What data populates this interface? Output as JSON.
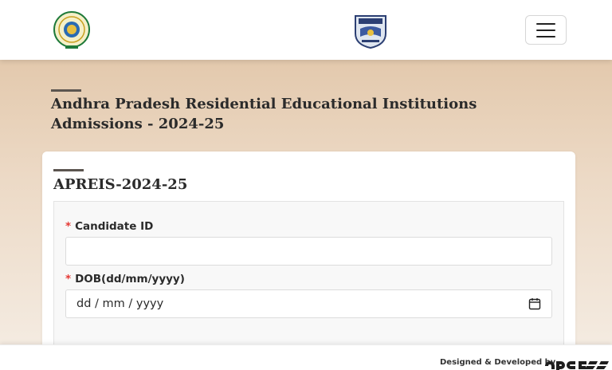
{
  "header": {
    "left_logo_icon": "andhra-pradesh-emblem-icon",
    "center_logo_icon": "apreis-crest-icon",
    "menu_icon": "hamburger-menu-icon"
  },
  "page": {
    "title": "Andhra Pradesh Residential Educational Institutions Admissions - 2024-25"
  },
  "card": {
    "title": "APREIS-2024-25"
  },
  "form": {
    "required_mark": "*",
    "candidate_id_label": "Candidate ID",
    "candidate_id_value": "",
    "dob_label": "DOB(dd/mm/yyyy)",
    "dob_placeholder": "dd / mm / yyyy"
  },
  "footer": {
    "credit_text": "Designed & Developed by",
    "brand_logo_icon": "apcfss-logo-icon"
  },
  "colors": {
    "required": "#e53935",
    "text": "#2b2b2b",
    "hero_top": "#e3c9ad",
    "hero_bottom": "#f4ebe1"
  }
}
